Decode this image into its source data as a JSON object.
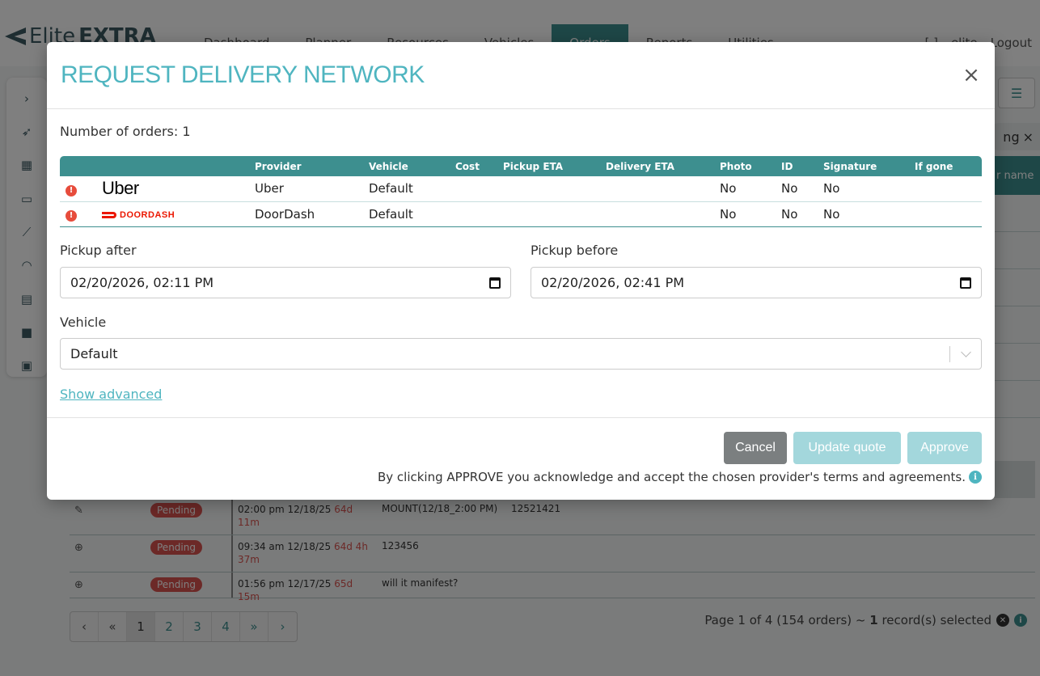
{
  "app": {
    "logo_light": "Elite",
    "logo_bold": "EXTRA",
    "nav": [
      "Dashboard",
      "Planner",
      "Resources",
      "Vehicles",
      "Orders",
      "Reports",
      "Utilities"
    ],
    "nav_active": "Orders",
    "nav_right": [
      "[ ]",
      "elite",
      "Logout"
    ],
    "filter_chip_text": "ng",
    "table_head_fragment": "r name"
  },
  "background_table": {
    "rows": [
      {
        "icon": "wrench-icon",
        "status": "Pending",
        "date": "02:00 pm 12/18/25",
        "ago": "64d 11m",
        "description": "MOUNT(12/18_2:00 PM)",
        "ref": "12521421"
      },
      {
        "icon": "globe-icon",
        "status": "Pending",
        "date": "09:34 am 12/18/25",
        "ago": "64d 4h 37m",
        "description": "123456",
        "ref": ""
      },
      {
        "icon": "globe-icon",
        "status": "Pending",
        "date": "01:56 pm 12/17/25",
        "ago": "65d 15m",
        "description": "will it manifest?",
        "ref": ""
      }
    ]
  },
  "pager": {
    "prev": "‹",
    "first": "«",
    "pages": [
      "1",
      "2",
      "3",
      "4"
    ],
    "current": "1",
    "last": "»",
    "next": "›",
    "info_prefix": "Page 1 of 4 (154 orders) ~ ",
    "info_count": "1",
    "info_suffix": " record(s) selected"
  },
  "modal": {
    "title": "REQUEST DELIVERY NETWORK",
    "close_glyph": "×",
    "order_count": "Number of orders: 1",
    "table": {
      "columns": [
        "",
        "",
        "Provider",
        "Vehicle",
        "Cost",
        "Pickup ETA",
        "Delivery ETA",
        "Photo",
        "ID",
        "Signature",
        "If gone"
      ],
      "rows": [
        {
          "logo": "Uber",
          "provider": "Uber",
          "vehicle": "Default",
          "cost": "",
          "pickup_eta": "",
          "delivery_eta": "",
          "photo": "No",
          "id": "No",
          "signature": "No",
          "if_gone": ""
        },
        {
          "logo": "DOORDASH",
          "provider": "DoorDash",
          "vehicle": "Default",
          "cost": "",
          "pickup_eta": "",
          "delivery_eta": "",
          "photo": "No",
          "id": "No",
          "signature": "No",
          "if_gone": ""
        }
      ]
    },
    "pickup_after_label": "Pickup after",
    "pickup_after_value": "02/20/2026, 02:11 PM",
    "pickup_before_label": "Pickup before",
    "pickup_before_value": "02/20/2026, 02:41 PM",
    "vehicle_label": "Vehicle",
    "vehicle_value": "Default",
    "show_advanced": "Show advanced",
    "cancel": "Cancel",
    "update_quote": "Update quote",
    "approve": "Approve",
    "terms": "By clicking APPROVE you acknowledge and accept the chosen provider's terms and agreements.",
    "colors": {
      "accent": "#4fb5c0",
      "table_header": "#3d8f8f",
      "danger": "#e74c3c",
      "doordash": "#eb1700"
    }
  }
}
